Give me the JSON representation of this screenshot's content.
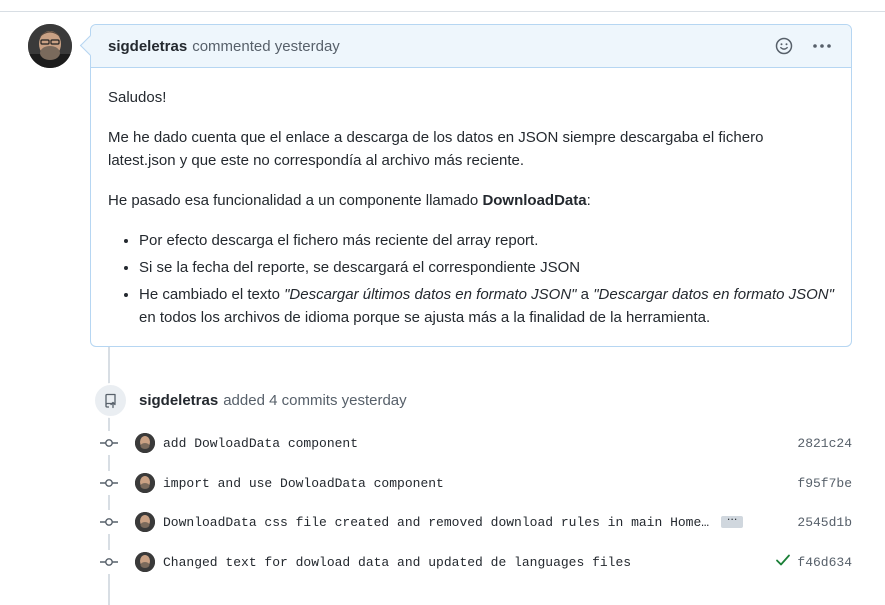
{
  "comment": {
    "author": "sigdeletras",
    "action": "commented yesterday",
    "greeting": "Saludos!",
    "paragraph1": "Me he dado cuenta que el enlace a descarga de los datos en JSON siempre descargaba el fichero latest.json y que este no correspondía al archivo más reciente.",
    "paragraph2_prefix": "He pasado esa funcionalidad a un componente llamado ",
    "paragraph2_bold": "DownloadData",
    "paragraph2_suffix": ":",
    "bullet1": "Por efecto descarga el fichero más reciente del array report.",
    "bullet2": "Si se la fecha del reporte, se descargará el correspondiente JSON",
    "bullet3_prefix": "He cambiado el texto ",
    "bullet3_em1": "\"Descargar últimos datos en formato JSON\"",
    "bullet3_mid": " a ",
    "bullet3_em2": "\"Descargar datos en formato JSON\"",
    "bullet3_suffix": " en todos los archivos de idioma porque se ajusta más a la finalidad de la herramienta."
  },
  "commits_event": {
    "author": "sigdeletras",
    "action": "added 4 commits yesterday"
  },
  "commits": [
    {
      "message": "add DowloadData component",
      "sha": "2821c24"
    },
    {
      "message": "import and use DowloadData component",
      "sha": "f95f7be"
    },
    {
      "message": "DownloadData css file created and removed download rules in main Home…",
      "sha": "2545d1b",
      "ellipsis": "···"
    },
    {
      "message": "Changed text for dowload data and updated de languages files",
      "sha": "f46d634",
      "status": "success"
    }
  ],
  "colors": {
    "header_bg": "#eef6fc",
    "border": "#b6d6f2",
    "success": "#1a7f37",
    "muted": "#57606a"
  },
  "icons": {
    "reaction": "smiley-icon",
    "menu": "kebab-horizontal-icon",
    "commits": "repo-push-icon",
    "commit": "git-commit-icon",
    "status": "check-icon"
  }
}
